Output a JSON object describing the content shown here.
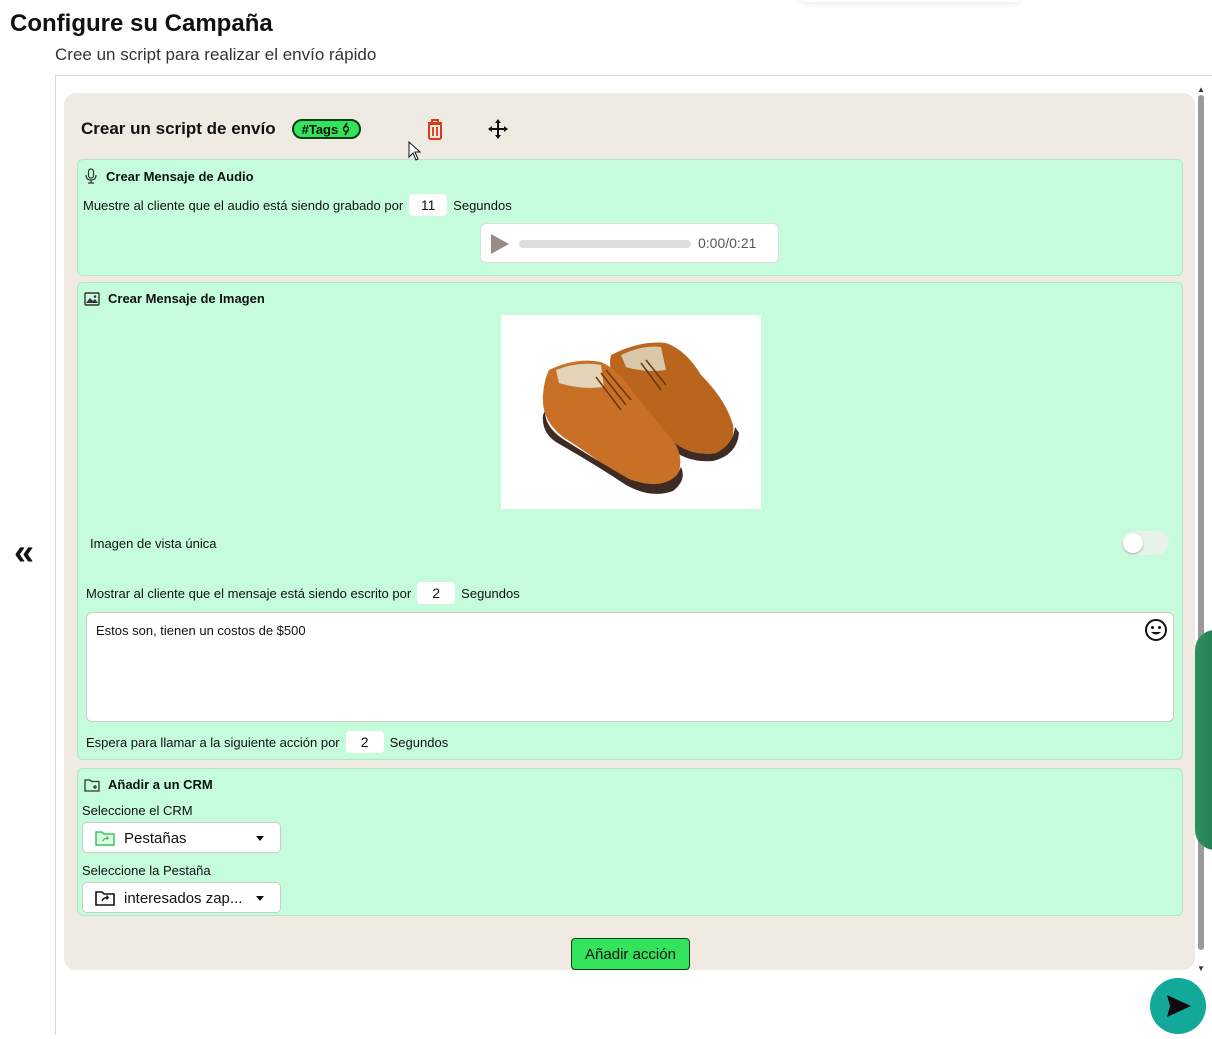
{
  "page": {
    "title": "Configure su Campaña",
    "subtitle": "Cree un script para realizar el envío rápido"
  },
  "script": {
    "title": "Crear un script de envío",
    "tags_label": "#Tags"
  },
  "audio": {
    "header": "Crear Mensaje de Audio",
    "recording_prefix": "Muestre al cliente que el audio está siendo grabado por",
    "recording_seconds": "11",
    "seconds_label": "Segundos",
    "time": "0:00/0:21"
  },
  "image_msg": {
    "header": "Crear Mensaje de Imagen",
    "single_view_label": "Imagen de vista única",
    "single_view_enabled": false,
    "typing_prefix": "Mostrar al cliente que el mensaje está siendo escrito por",
    "typing_seconds": "2",
    "seconds_label": "Segundos",
    "message": "Estos son, tienen un costos de $500",
    "wait_prefix": "Espera para llamar a la siguiente acción por",
    "wait_seconds": "2"
  },
  "crm": {
    "header": "Añadir a un CRM",
    "crm_label": "Seleccione el CRM",
    "crm_value": "Pestañas",
    "tab_label": "Seleccione la Pestaña",
    "tab_value": "interesados zap..."
  },
  "add_action_label": "Añadir acción",
  "colors": {
    "card_bg": "#c4fcdc",
    "panel_bg": "#efebe2",
    "accent_green": "#34e35c",
    "delete_red": "#d83a1c",
    "send_teal": "#12a89a"
  },
  "icons": [
    "chevrons-left-icon",
    "trash-icon",
    "move-icon",
    "microphone-icon",
    "play-icon",
    "image-icon",
    "emoji-icon",
    "folder-plus-icon",
    "folder-shared-icon",
    "send-icon"
  ]
}
